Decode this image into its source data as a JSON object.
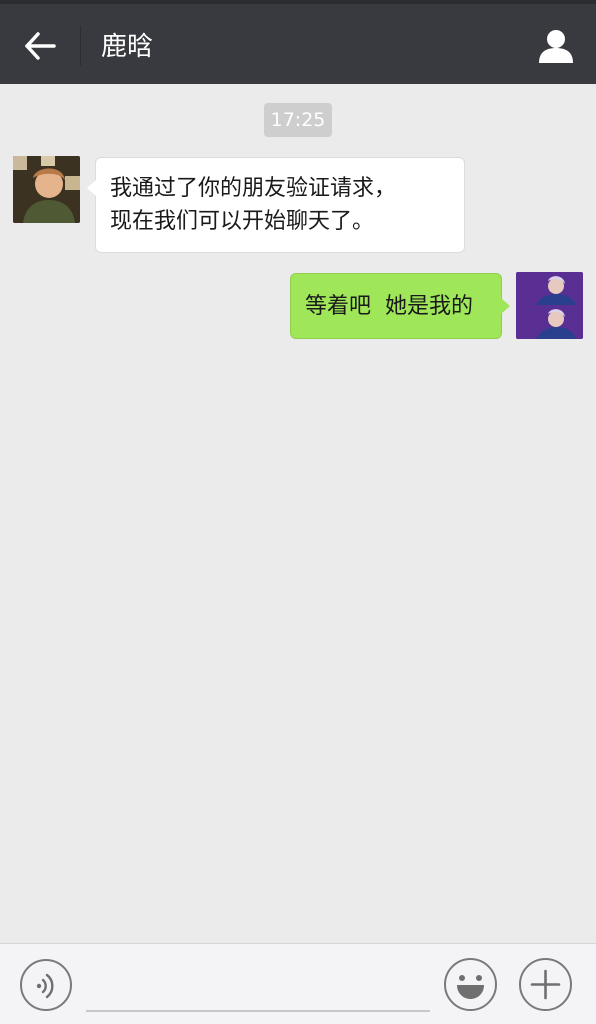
{
  "header": {
    "title": "鹿晗",
    "back_icon": "arrow-left-icon",
    "profile_icon": "person-icon",
    "bg_color": "#393a3f"
  },
  "chat": {
    "timestamp": "17:25",
    "messages": [
      {
        "side": "left",
        "lines": [
          "我通过了你的朋友验证请求，",
          "现在我们可以开始聊天了。"
        ]
      },
      {
        "side": "right",
        "lines": [
          "等着吧  她是我的"
        ],
        "bubble_color": "#9fe658"
      }
    ]
  },
  "composer": {
    "voice_icon": "voice-icon",
    "emoji_icon": "emoji-icon",
    "plus_icon": "plus-icon",
    "input_value": ""
  }
}
